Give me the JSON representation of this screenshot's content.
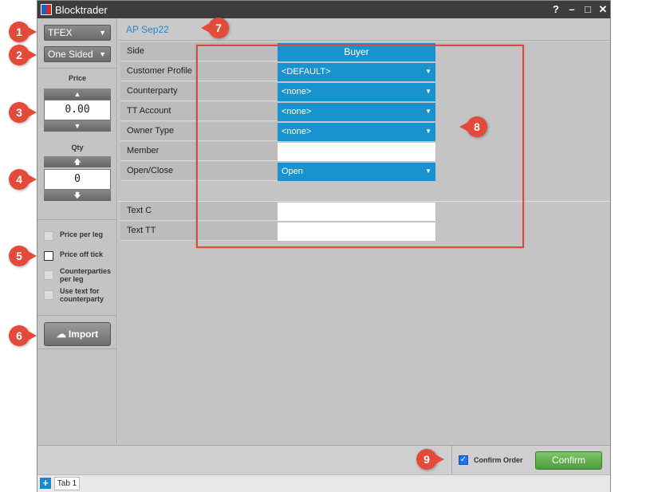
{
  "window": {
    "title": "Blocktrader"
  },
  "titlebar_icons": [
    "help-icon",
    "minimize-icon",
    "maximize-icon",
    "close-icon"
  ],
  "left_panel": {
    "exchange": "TFEX",
    "order_type": "One Sided",
    "price_label": "Price",
    "price_value": "0.00",
    "qty_label": "Qty",
    "qty_value": "0",
    "checkboxes": [
      {
        "label": "Price per leg",
        "checked": false
      },
      {
        "label": "Price off tick",
        "checked": false
      },
      {
        "label": "Counterparties per leg",
        "checked": false
      },
      {
        "label": "Use text for counterparty",
        "checked": false
      }
    ],
    "import_label": "Import"
  },
  "header": {
    "instrument": "AP Sep22"
  },
  "form": {
    "rows": [
      {
        "label": "Side",
        "value": "Buyer"
      },
      {
        "label": "Customer Profile",
        "value": "<DEFAULT>"
      },
      {
        "label": "Counterparty",
        "value": "<none>"
      },
      {
        "label": "TT Account",
        "value": "<none>"
      },
      {
        "label": "Owner Type",
        "value": "<none>"
      },
      {
        "label": "Member",
        "value": ""
      },
      {
        "label": "Open/Close",
        "value": "Open"
      }
    ],
    "text_rows": [
      {
        "label": "Text C",
        "value": ""
      },
      {
        "label": "Text TT",
        "value": ""
      }
    ]
  },
  "footer": {
    "confirm_order_label": "Confirm Order",
    "confirm_order_checked": true,
    "confirm_button": "Confirm"
  },
  "tabs": [
    {
      "label": "Tab 1"
    }
  ],
  "callouts": [
    "1",
    "2",
    "3",
    "4",
    "5",
    "6",
    "7",
    "8",
    "9"
  ],
  "colors": {
    "accent_blue": "#1993d0",
    "confirm_green": "#5aab46",
    "callout_red": "#e24b3a",
    "instrument_blue": "#2b86c8"
  }
}
